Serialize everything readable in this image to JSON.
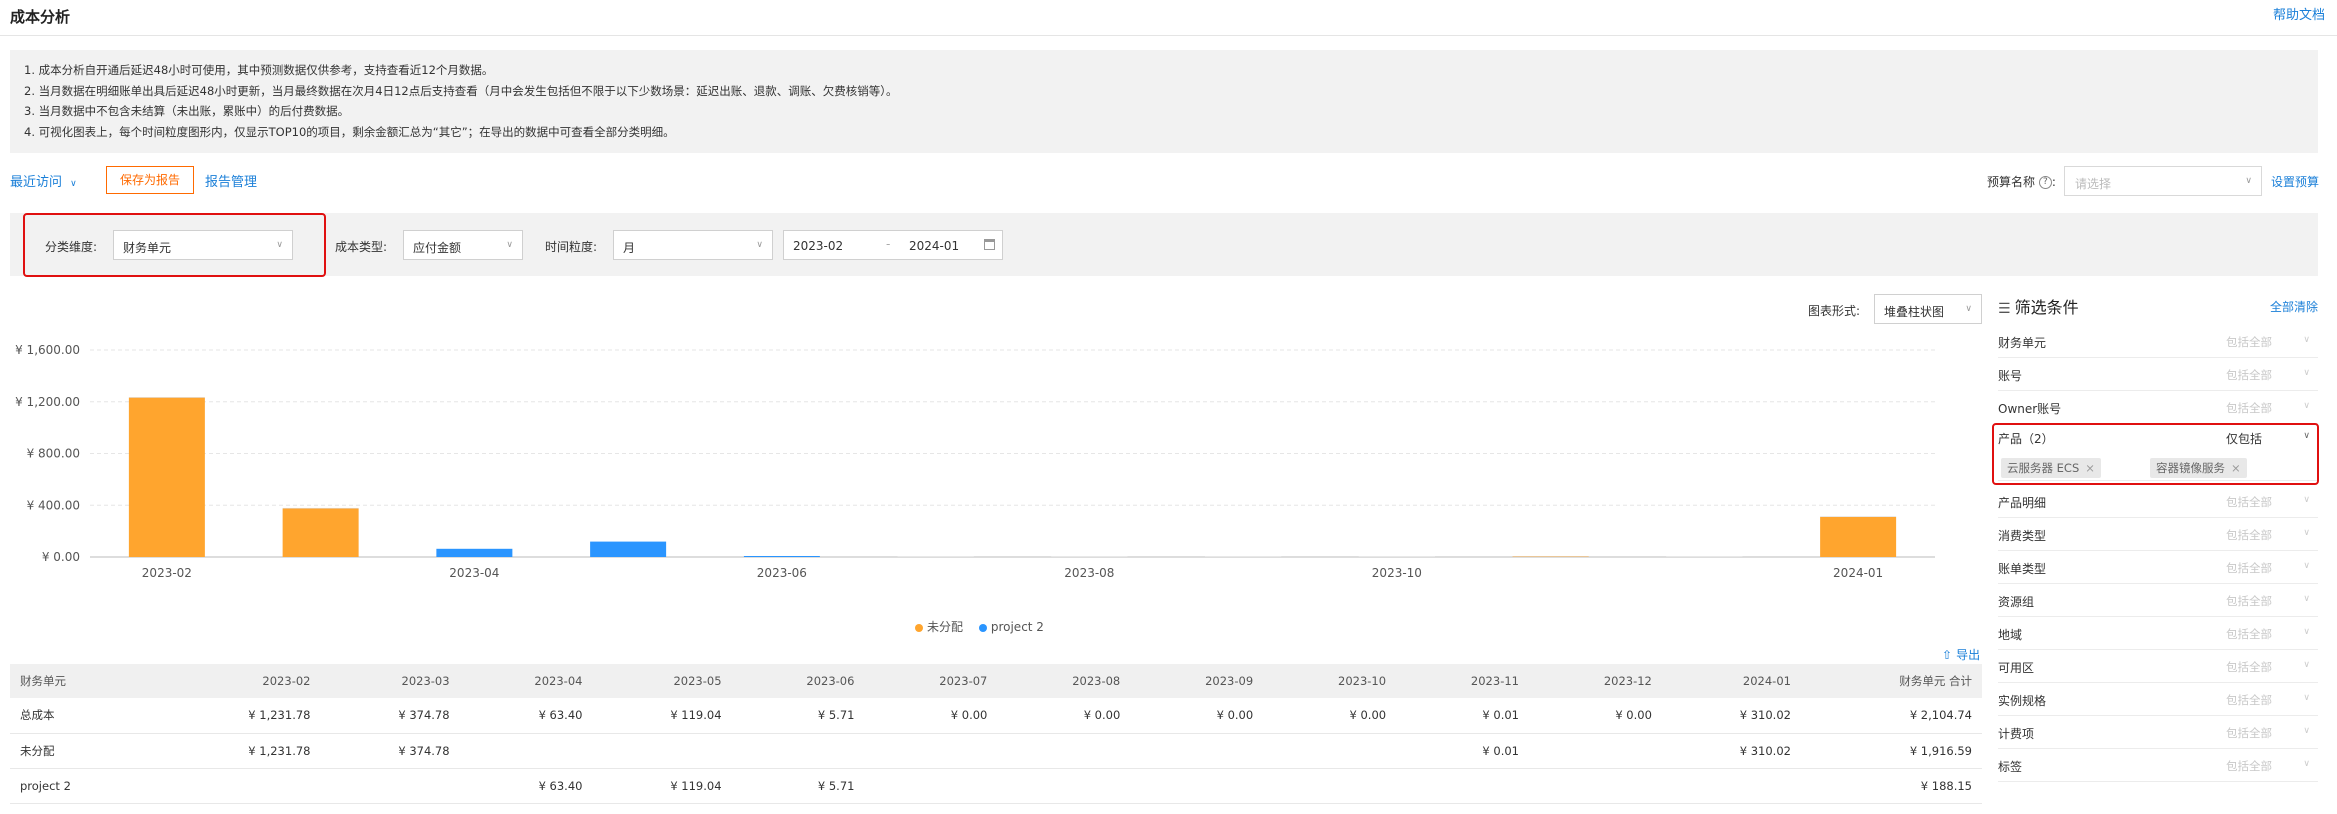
{
  "header": {
    "title": "成本分析",
    "help": "帮助文档"
  },
  "notice": [
    "1. 成本分析自开通后延迟48小时可使用，其中预测数据仅供参考，支持查看近12个月数据。",
    "2. 当月数据在明细账单出具后延迟48小时更新，当月最终数据在次月4日12点后支持查看（月中会发生包括但不限于以下少数场景：延迟出账、退款、调账、欠费核销等）。",
    "3. 当月数据中不包含未结算（未出账，累账中）的后付费数据。",
    "4. 可视化图表上，每个时间粒度图形内，仅显示TOP10的项目，剩余金额汇总为“其它”；在导出的数据中可查看全部分类明细。"
  ],
  "toolbar": {
    "recent": "最近访问",
    "save_report": "保存为报告",
    "report_mgmt": "报告管理",
    "budget_label": "预算名称",
    "budget_placeholder": "请选择",
    "budget_set": "设置预算"
  },
  "filters": {
    "dimension_label": "分类维度:",
    "dimension_value": "财务单元",
    "cost_type_label": "成本类型:",
    "cost_type_value": "应付金额",
    "granularity_label": "时间粒度:",
    "granularity_value": "月",
    "date_start": "2023-02",
    "date_end": "2024-01",
    "chart_form_label": "图表形式:",
    "chart_form_value": "堆叠柱状图"
  },
  "chart_data": {
    "type": "bar",
    "stacked": true,
    "categories": [
      "2023-02",
      "2023-03",
      "2023-04",
      "2023-05",
      "2023-06",
      "2023-07",
      "2023-08",
      "2023-09",
      "2023-10",
      "2023-11",
      "2023-12",
      "2024-01"
    ],
    "x_tick_labels": [
      "2023-02",
      "2023-04",
      "2023-06",
      "2023-08",
      "2023-10",
      "2024-01"
    ],
    "y_tick_labels": [
      "¥ 0.00",
      "¥ 400.00",
      "¥ 800.00",
      "¥ 1,200.00",
      "¥ 1,600.00"
    ],
    "ylim": [
      0,
      1600
    ],
    "grid": true,
    "legend_position": "bottom",
    "series": [
      {
        "name": "未分配",
        "color": "#ffa52e",
        "values": [
          1231.78,
          374.78,
          0,
          0,
          0,
          0,
          0,
          0,
          0,
          0.01,
          0,
          310.02
        ]
      },
      {
        "name": "project 2",
        "color": "#2a95ff",
        "values": [
          0,
          0,
          63.4,
          119.04,
          5.71,
          0,
          0,
          0,
          0,
          0,
          0,
          0
        ]
      }
    ]
  },
  "table": {
    "headers": [
      "财务单元",
      "2023-02",
      "2023-03",
      "2023-04",
      "2023-05",
      "2023-06",
      "2023-07",
      "2023-08",
      "2023-09",
      "2023-10",
      "2023-11",
      "2023-12",
      "2024-01",
      "财务单元 合计"
    ],
    "rows": [
      [
        "总成本",
        "¥ 1,231.78",
        "¥ 374.78",
        "¥ 63.40",
        "¥ 119.04",
        "¥ 5.71",
        "¥ 0.00",
        "¥ 0.00",
        "¥ 0.00",
        "¥ 0.00",
        "¥ 0.01",
        "¥ 0.00",
        "¥ 310.02",
        "¥ 2,104.74"
      ],
      [
        "未分配",
        "¥ 1,231.78",
        "¥ 374.78",
        "",
        "",
        "",
        "",
        "",
        "",
        "",
        "¥ 0.01",
        "",
        "¥ 310.02",
        "¥ 1,916.59"
      ],
      [
        "project 2",
        "",
        "",
        "¥ 63.40",
        "¥ 119.04",
        "¥ 5.71",
        "",
        "",
        "",
        "",
        "",
        "",
        "",
        "¥ 188.15"
      ]
    ]
  },
  "export": "导出",
  "filter_panel": {
    "title": "筛选条件",
    "clear": "全部清除",
    "all_label": "包括全部",
    "items_top": [
      "财务单元",
      "账号",
      "Owner账号"
    ],
    "product": {
      "name": "产品（2）",
      "mode": "仅包括",
      "tags": [
        "云服务器 ECS",
        "容器镜像服务"
      ]
    },
    "items_bottom": [
      "产品明细",
      "消费类型",
      "账单类型",
      "资源组",
      "地域",
      "可用区",
      "实例规格",
      "计费项",
      "标签"
    ]
  }
}
